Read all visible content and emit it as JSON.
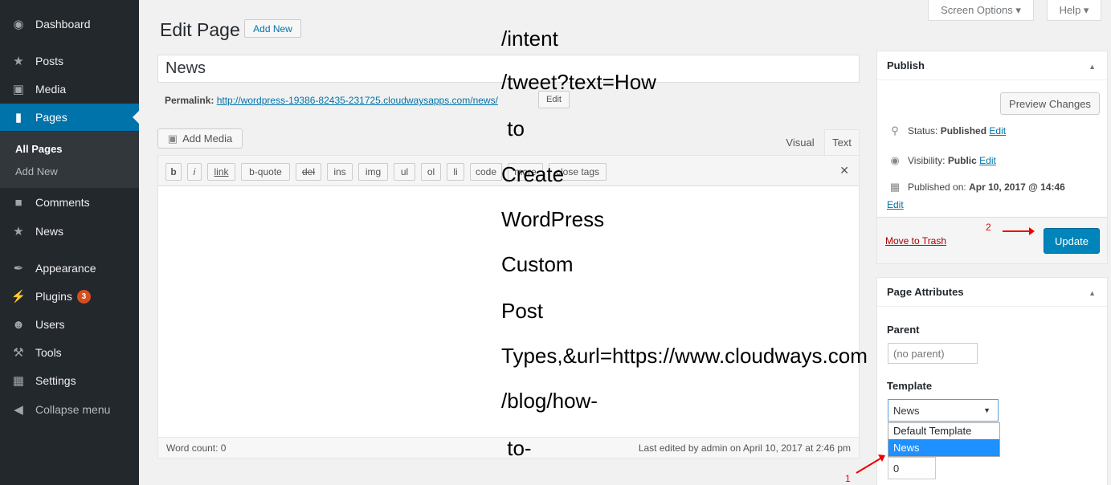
{
  "sidebar": {
    "items": [
      {
        "label": "Dashboard",
        "icon": "dashboard-icon",
        "glyph": "◉"
      },
      {
        "label": "Posts",
        "icon": "pushpin-icon",
        "glyph": "★"
      },
      {
        "label": "Media",
        "icon": "media-icon",
        "glyph": "▣"
      },
      {
        "label": "Pages",
        "icon": "page-icon",
        "glyph": "▮"
      },
      {
        "label": "Comments",
        "icon": "comment-icon",
        "glyph": "■"
      },
      {
        "label": "News",
        "icon": "pushpin-icon",
        "glyph": "★"
      },
      {
        "label": "Appearance",
        "icon": "paintbrush-icon",
        "glyph": "✒"
      },
      {
        "label": "Plugins",
        "icon": "plugin-icon",
        "glyph": "⚡"
      },
      {
        "label": "Users",
        "icon": "users-icon",
        "glyph": "☻"
      },
      {
        "label": "Tools",
        "icon": "wrench-icon",
        "glyph": "⚒"
      },
      {
        "label": "Settings",
        "icon": "settings-icon",
        "glyph": "▦"
      },
      {
        "label": "Collapse menu",
        "icon": "collapse-icon",
        "glyph": "◀"
      }
    ],
    "submenu": {
      "all_pages": "All Pages",
      "add_new": "Add New"
    },
    "plugins_badge": "3"
  },
  "screen_meta": {
    "screen_options": "Screen Options ▾",
    "help": "Help ▾"
  },
  "header": {
    "title": "Edit Page",
    "add_new": "Add New"
  },
  "post": {
    "title": "News",
    "permalink_label": "Permalink:",
    "permalink_url": "http://wordpress-19386-82435-231725.cloudwaysapps.com/news/",
    "permalink_edit": "Edit"
  },
  "editor": {
    "add_media": "Add Media",
    "tabs": {
      "visual": "Visual",
      "text": "Text"
    },
    "quicktags": [
      "b",
      "i",
      "link",
      "b-quote",
      "del",
      "ins",
      "img",
      "ul",
      "ol",
      "li",
      "code",
      "more",
      "close tags"
    ],
    "fullscreen_icon": "fullscreen-icon",
    "word_count": "Word count: 0",
    "last_edited": "Last edited by admin on April 10, 2017 at 2:46 pm"
  },
  "publish": {
    "title": "Publish",
    "preview": "Preview Changes",
    "status_label": "Status:",
    "status_value": "Published",
    "visibility_label": "Visibility:",
    "visibility_value": "Public",
    "published_label": "Published on:",
    "published_value": "Apr 10, 2017 @ 14:46",
    "edit": "Edit",
    "move_to_trash": "Move to Trash",
    "update": "Update"
  },
  "page_attributes": {
    "title": "Page Attributes",
    "parent_label": "Parent",
    "parent_value": "(no parent)",
    "template_label": "Template",
    "template_value": "News",
    "template_options": [
      "Default Template",
      "News"
    ],
    "order_value": "0"
  },
  "annotations": {
    "step1": "1",
    "step2": "2"
  },
  "overlay_text": [
    "/intent",
    "/tweet?text=How",
    " to",
    "Create",
    "WordPress",
    "Custom",
    "Post",
    "Types,&url=https://www.cloudways.com",
    "/blog/how-",
    " to-"
  ]
}
